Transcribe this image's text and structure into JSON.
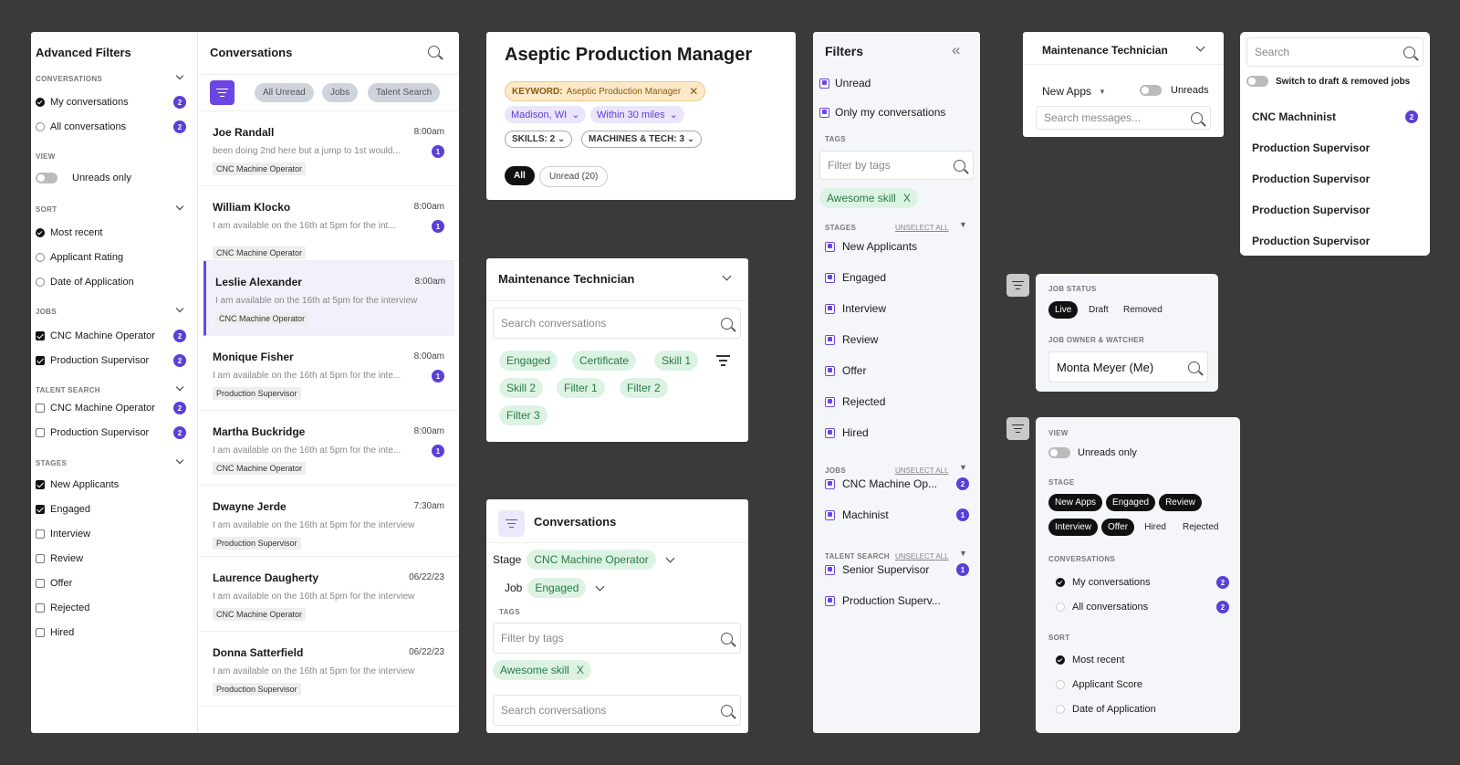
{
  "advanced_filters": {
    "title": "Advanced Filters",
    "conversations_label": "CONVERSATIONS",
    "conversations": [
      {
        "label": "My conversations",
        "count": "2",
        "on": true
      },
      {
        "label": "All conversations",
        "count": "2",
        "on": false
      }
    ],
    "view_label": "VIEW",
    "unreads_only": "Unreads only",
    "sort_label": "SORT",
    "sort": [
      "Most recent",
      "Applicant Rating",
      "Date of Application"
    ],
    "jobs_label": "JOBS",
    "jobs": [
      {
        "label": "CNC Machine Operator",
        "count": "2"
      },
      {
        "label": "Production Supervisor",
        "count": "2"
      }
    ],
    "talent_label": "TALENT SEARCH",
    "talent": [
      {
        "label": "CNC Machine Operator",
        "count": "2"
      },
      {
        "label": "Production Supervisor",
        "count": "2"
      }
    ],
    "stages_label": "STAGES",
    "stages": [
      {
        "label": "New Applicants",
        "on": true
      },
      {
        "label": "Engaged",
        "on": true
      },
      {
        "label": "Interview",
        "on": false
      },
      {
        "label": "Review",
        "on": false
      },
      {
        "label": "Offer",
        "on": false
      },
      {
        "label": "Rejected",
        "on": false
      },
      {
        "label": "Hired",
        "on": false
      }
    ]
  },
  "conversations_list": {
    "title": "Conversations",
    "tabs": [
      "All Unread",
      "Jobs",
      "Talent Search"
    ],
    "items": [
      {
        "name": "Joe Randall",
        "time": "8:00am",
        "msg": "been doing 2nd here but a jump to 1st would...",
        "badge": "1",
        "job": "CNC Machine Operator"
      },
      {
        "name": "William Klocko",
        "time": "8:00am",
        "msg": "I am available on the 16th at 5pm for the int...",
        "badge": "1",
        "job": "CNC Machine Operator"
      },
      {
        "name": "Leslie Alexander",
        "time": "8:00am",
        "msg": "I am available on the 16th at 5pm for the interview",
        "badge": "",
        "job": "CNC Machine Operator"
      },
      {
        "name": "Monique Fisher",
        "time": "8:00am",
        "msg": "I am available on the 16th at 5pm for the inte...",
        "badge": "1",
        "job": "Production Supervisor"
      },
      {
        "name": "Martha Buckridge",
        "time": "8:00am",
        "msg": "I am available on the 16th at 5pm for the inte...",
        "badge": "1",
        "job": "CNC Machine Operator"
      },
      {
        "name": "Dwayne Jerde",
        "time": "7:30am",
        "msg": "I am available on the 16th at 5pm for the interview",
        "badge": "",
        "job": "Production Supervisor"
      },
      {
        "name": "Laurence Daugherty",
        "time": "06/22/23",
        "msg": "I am available on the 16th at 5pm for the interview",
        "badge": "",
        "job": "CNC Machine Operator"
      },
      {
        "name": "Donna Satterfield",
        "time": "06/22/23",
        "msg": "I am available on the 16th at 5pm for the interview",
        "badge": "",
        "job": "Production Supervisor"
      }
    ]
  },
  "aseptic": {
    "title": "Aseptic Production Manager",
    "keyword_label": "KEYWORD:",
    "keyword_value": "Aseptic Production Manager",
    "location": "Madison, WI",
    "distance": "Within 30 miles",
    "skills": "SKILLS: 2",
    "machines": "MACHINES & TECH: 3",
    "all": "All",
    "unread": "Unread (20)"
  },
  "maint_panel": {
    "title": "Maintenance Technician",
    "search_placeholder": "Search conversations",
    "tags": [
      "Engaged",
      "Certificate",
      "Skill 1",
      "Skill 2",
      "Filter 1",
      "Filter 2",
      "Filter 3"
    ]
  },
  "conv_panel": {
    "title": "Conversations",
    "stage_label": "Stage",
    "stage_value": "CNC Machine Operator",
    "job_label": "Job",
    "job_value": "Engaged",
    "tags_label": "TAGS",
    "tags_placeholder": "Filter by tags",
    "tag": "Awesome skill",
    "tag_x": "X",
    "search_placeholder": "Search conversations"
  },
  "filters": {
    "title": "Filters",
    "unread": "Unread",
    "only_mine": "Only my conversations",
    "tags_label": "TAGS",
    "tags_placeholder": "Filter by tags",
    "tag": "Awesome skill",
    "tag_x": "X",
    "stages_label": "STAGES",
    "unselect": "UNSELECT ALL",
    "stages": [
      "New Applicants",
      "Engaged",
      "Interview",
      "Review",
      "Offer",
      "Rejected",
      "Hired"
    ],
    "jobs_label": "JOBS",
    "jobs": [
      {
        "label": "CNC Machine Op...",
        "count": "2"
      },
      {
        "label": "Machinist",
        "count": "1"
      }
    ],
    "talent_label": "TALENT SEARCH",
    "talent": [
      {
        "label": "Senior Supervisor",
        "count": "1"
      },
      {
        "label": "Production Superv...",
        "count": ""
      }
    ]
  },
  "maint_top": {
    "title": "Maintenance Technician",
    "new_apps": "New Apps",
    "unreads": "Unreads",
    "search_placeholder": "Search messages..."
  },
  "job_switch": {
    "search_placeholder": "Search",
    "switch_label": "Switch to draft & removed jobs",
    "jobs": [
      {
        "label": "CNC Machninist",
        "count": "2"
      },
      {
        "label": "Production Supervisor",
        "count": ""
      },
      {
        "label": "Production Supervisor",
        "count": ""
      },
      {
        "label": "Production Supervisor",
        "count": ""
      },
      {
        "label": "Production Supervisor",
        "count": ""
      }
    ]
  },
  "job_status": {
    "status_label": "JOB STATUS",
    "statuses": [
      "Live",
      "Draft",
      "Removed"
    ],
    "owner_label": "JOB OWNER & WATCHER",
    "owner": "Monta Meyer (Me)"
  },
  "view_panel": {
    "view_label": "VIEW",
    "unreads_only": "Unreads only",
    "stage_label": "STAGE",
    "stages": [
      {
        "label": "New Apps",
        "on": true
      },
      {
        "label": "Engaged",
        "on": true
      },
      {
        "label": "Review",
        "on": true
      },
      {
        "label": "Interview",
        "on": true
      },
      {
        "label": "Offer",
        "on": true
      },
      {
        "label": "Hired",
        "on": false
      },
      {
        "label": "Rejected",
        "on": false
      }
    ],
    "conversations_label": "CONVERSATIONS",
    "conversations": [
      {
        "label": "My conversations",
        "count": "2",
        "on": true
      },
      {
        "label": "All conversations",
        "count": "2",
        "on": false
      }
    ],
    "sort_label": "SORT",
    "sort": [
      {
        "label": "Most recent",
        "on": true
      },
      {
        "label": "Applicant Score",
        "on": false
      },
      {
        "label": "Date of Application",
        "on": false
      }
    ]
  },
  "colors": {
    "accent": "#6b46e5",
    "tag_green": "#dcf3e3",
    "keyword": "#fde9c8"
  }
}
